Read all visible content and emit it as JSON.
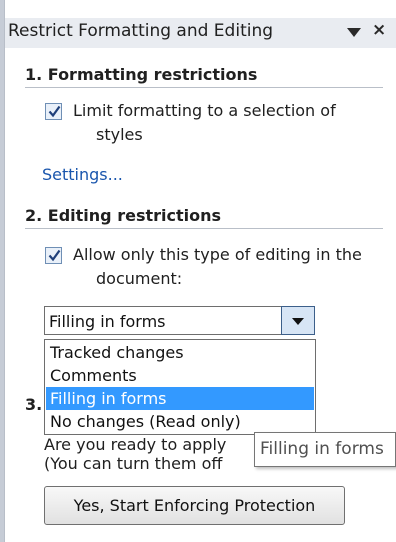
{
  "pane": {
    "title": "Restrict Formatting and Editing",
    "close_glyph": "×",
    "dropdown_icon": "triangle-down-icon"
  },
  "formatting": {
    "heading": "1. Formatting restrictions",
    "checkbox_checked": true,
    "checkbox_line1": "Limit formatting to a selection of",
    "checkbox_line2": "styles",
    "settings_link": "Settings..."
  },
  "editing": {
    "heading": "2. Editing restrictions",
    "checkbox_checked": true,
    "checkbox_line1": "Allow only this type of editing in the",
    "checkbox_line2": "document:",
    "selected_value": "Filling in forms",
    "options": [
      "Tracked changes",
      "Comments",
      "Filling in forms",
      "No changes (Read only)"
    ],
    "selected_index": 2
  },
  "enforcement": {
    "heading_number": "3.",
    "question_partial": "Are you ready to apply",
    "note_partial": "(You can turn them off",
    "button_label": "Yes, Start Enforcing Protection"
  },
  "tooltip": {
    "text": "Filling in forms"
  },
  "colors": {
    "selection": "#3399ff",
    "link": "#1a56ad",
    "title_bar": "#e9ecf1"
  }
}
